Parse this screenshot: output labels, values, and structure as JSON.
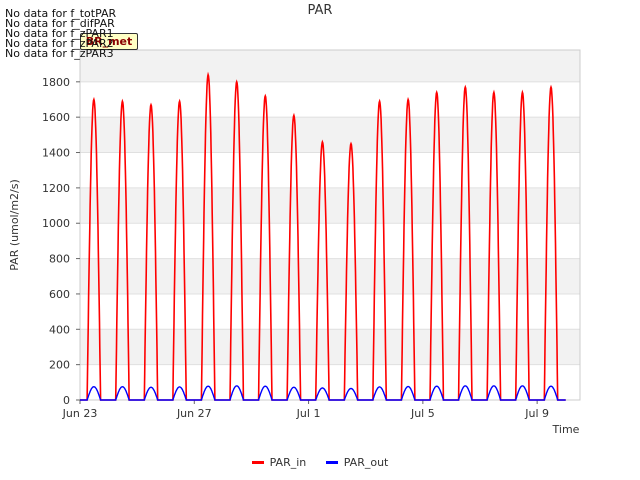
{
  "nodata_messages": [
    "No data for f_totPAR",
    "No data for f_difPAR",
    "No data for f_zPAR1",
    "No data for f_zPAR2",
    "No data for f_zPAR3"
  ],
  "badge_text": "BR_met",
  "chart_data": {
    "type": "line",
    "title": "PAR",
    "xlabel": "Time",
    "ylabel": "PAR (umol/m2/s)",
    "x_ticks": [
      "Jun 23",
      "Jun 27",
      "Jul 1",
      "Jul 5",
      "Jul 9"
    ],
    "x_range": [
      "2023-06-23",
      "2023-07-10 12:00"
    ],
    "ylim": [
      0,
      1980
    ],
    "y_ticks": [
      0,
      200,
      400,
      600,
      800,
      1000,
      1200,
      1400,
      1600,
      1800
    ],
    "grid": "horizontal bands",
    "legend_position": "bottom",
    "series": [
      {
        "name": "PAR_in",
        "color": "#ff0000",
        "daily_peaks": [
          {
            "date": "2023-06-23",
            "peak": 1700
          },
          {
            "date": "2023-06-24",
            "peak": 1690
          },
          {
            "date": "2023-06-25",
            "peak": 1670
          },
          {
            "date": "2023-06-26",
            "peak": 1690
          },
          {
            "date": "2023-06-27",
            "peak": 1840
          },
          {
            "date": "2023-06-28",
            "peak": 1800
          },
          {
            "date": "2023-06-29",
            "peak": 1720
          },
          {
            "date": "2023-06-30",
            "peak": 1610
          },
          {
            "date": "2023-07-01",
            "peak": 1460
          },
          {
            "date": "2023-07-02",
            "peak": 1450
          },
          {
            "date": "2023-07-03",
            "peak": 1690
          },
          {
            "date": "2023-07-04",
            "peak": 1700
          },
          {
            "date": "2023-07-05",
            "peak": 1740
          },
          {
            "date": "2023-07-06",
            "peak": 1770
          },
          {
            "date": "2023-07-07",
            "peak": 1740
          },
          {
            "date": "2023-07-08",
            "peak": 1740
          },
          {
            "date": "2023-07-09",
            "peak": 1770
          }
        ]
      },
      {
        "name": "PAR_out",
        "color": "#0000ff",
        "daily_peaks": [
          {
            "date": "2023-06-23",
            "peak": 75
          },
          {
            "date": "2023-06-24",
            "peak": 75
          },
          {
            "date": "2023-06-25",
            "peak": 72
          },
          {
            "date": "2023-06-26",
            "peak": 74
          },
          {
            "date": "2023-06-27",
            "peak": 78
          },
          {
            "date": "2023-06-28",
            "peak": 80
          },
          {
            "date": "2023-06-29",
            "peak": 78
          },
          {
            "date": "2023-06-30",
            "peak": 72
          },
          {
            "date": "2023-07-01",
            "peak": 68
          },
          {
            "date": "2023-07-02",
            "peak": 65
          },
          {
            "date": "2023-07-03",
            "peak": 74
          },
          {
            "date": "2023-07-04",
            "peak": 76
          },
          {
            "date": "2023-07-05",
            "peak": 78
          },
          {
            "date": "2023-07-06",
            "peak": 80
          },
          {
            "date": "2023-07-07",
            "peak": 80
          },
          {
            "date": "2023-07-08",
            "peak": 80
          },
          {
            "date": "2023-07-09",
            "peak": 78
          }
        ]
      }
    ]
  }
}
